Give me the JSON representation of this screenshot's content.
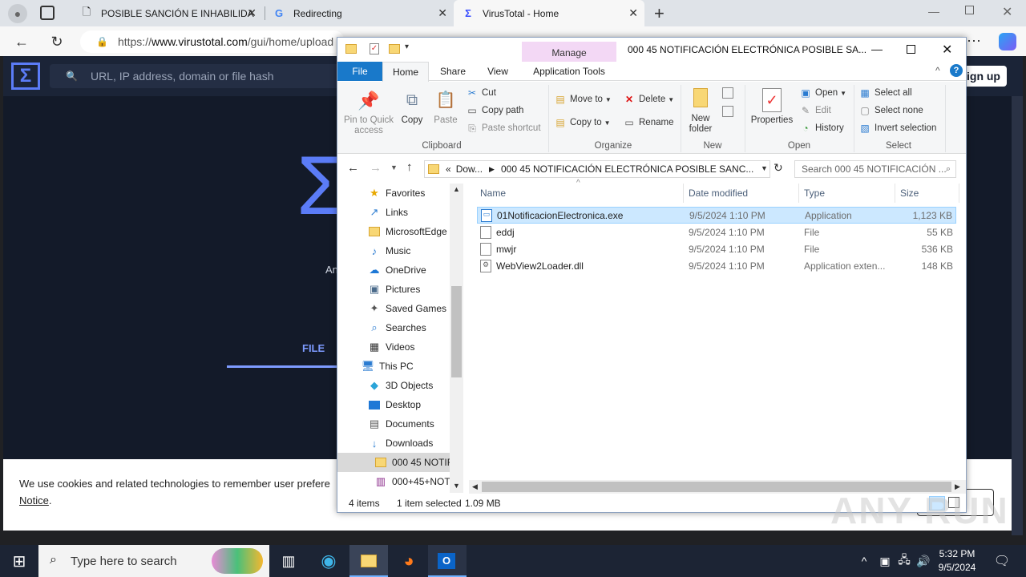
{
  "browser": {
    "tabs": [
      {
        "title": "POSIBLE SANCIÓN  E INHABILIDA",
        "icon": "document-icon"
      },
      {
        "title": "Redirecting",
        "icon": "google-icon"
      },
      {
        "title": "VirusTotal - Home",
        "icon": "virustotal-icon"
      }
    ],
    "url_prefix": "https://",
    "url_host": "www.virustotal.com",
    "url_path": "/gui/home/upload"
  },
  "virustotal": {
    "search_placeholder": "URL, IP address, domain or file hash",
    "signup": "ign up",
    "intro_fragment": "An",
    "file_tab": "FILE",
    "cookie_text": "We use cookies and related technologies to remember user prefere",
    "notice": "Notice",
    "notice_suffix": "."
  },
  "explorer": {
    "window_title": "000 45 NOTIFICACIÓN ELECTRÓNICA POSIBLE SA...",
    "contextual_tab": "Manage",
    "tabs": [
      "File",
      "Home",
      "Share",
      "View",
      "Application Tools"
    ],
    "ribbon": {
      "clipboard": {
        "pin": "Pin to Quick access",
        "copy": "Copy",
        "paste": "Paste",
        "cut": "Cut",
        "copy_path": "Copy path",
        "paste_shortcut": "Paste shortcut",
        "label": "Clipboard"
      },
      "organize": {
        "move_to": "Move to",
        "copy_to": "Copy to",
        "delete": "Delete",
        "rename": "Rename",
        "label": "Organize"
      },
      "new": {
        "new_folder": "New folder",
        "label": "New"
      },
      "open": {
        "properties": "Properties",
        "open": "Open",
        "edit": "Edit",
        "history": "History",
        "label": "Open"
      },
      "select": {
        "select_all": "Select all",
        "select_none": "Select none",
        "invert": "Invert selection",
        "label": "Select"
      }
    },
    "path": {
      "prefix": "«",
      "parent": "Dow...",
      "current": "000 45 NOTIFICACIÓN ELECTRÓNICA POSIBLE SANC..."
    },
    "search_placeholder": "Search 000 45 NOTIFICACIÓN ...",
    "nav_items": [
      {
        "label": "Favorites",
        "icon": "star-icon"
      },
      {
        "label": "Links",
        "icon": "links-icon"
      },
      {
        "label": "MicrosoftEdge",
        "icon": "folder-icon"
      },
      {
        "label": "Music",
        "icon": "music-icon"
      },
      {
        "label": "OneDrive",
        "icon": "cloud-icon"
      },
      {
        "label": "Pictures",
        "icon": "pictures-icon"
      },
      {
        "label": "Saved Games",
        "icon": "games-icon"
      },
      {
        "label": "Searches",
        "icon": "search-icon"
      },
      {
        "label": "Videos",
        "icon": "videos-icon"
      },
      {
        "label": "This PC",
        "icon": "computer-icon"
      },
      {
        "label": "3D Objects",
        "icon": "cube-icon"
      },
      {
        "label": "Desktop",
        "icon": "desktop-icon"
      },
      {
        "label": "Documents",
        "icon": "documents-icon"
      },
      {
        "label": "Downloads",
        "icon": "download-icon"
      },
      {
        "label": "000 45 NOTIFI",
        "icon": "folder-icon"
      },
      {
        "label": "000+45+NOT",
        "icon": "archive-icon"
      }
    ],
    "columns": [
      "Name",
      "Date modified",
      "Type",
      "Size"
    ],
    "files": [
      {
        "name": "01NotificacionElectronica.exe",
        "date": "9/5/2024 1:10 PM",
        "type": "Application",
        "size": "1,123 KB",
        "selected": true
      },
      {
        "name": "eddj",
        "date": "9/5/2024 1:10 PM",
        "type": "File",
        "size": "55 KB",
        "selected": false
      },
      {
        "name": "mwjr",
        "date": "9/5/2024 1:10 PM",
        "type": "File",
        "size": "536 KB",
        "selected": false
      },
      {
        "name": "WebView2Loader.dll",
        "date": "9/5/2024 1:10 PM",
        "type": "Application exten...",
        "size": "148 KB",
        "selected": false
      }
    ],
    "status": {
      "items": "4 items",
      "selected": "1 item selected",
      "size": "1.09 MB"
    }
  },
  "taskbar": {
    "search_placeholder": "Type here to search",
    "time": "5:32 PM",
    "date": "9/5/2024"
  },
  "watermark": "ANY RUN",
  "colors": {
    "selection": "#cce8ff",
    "file_tab": "#1979ca",
    "manage_tab": "#f3d8f5",
    "vt_bg": "#131a29"
  }
}
